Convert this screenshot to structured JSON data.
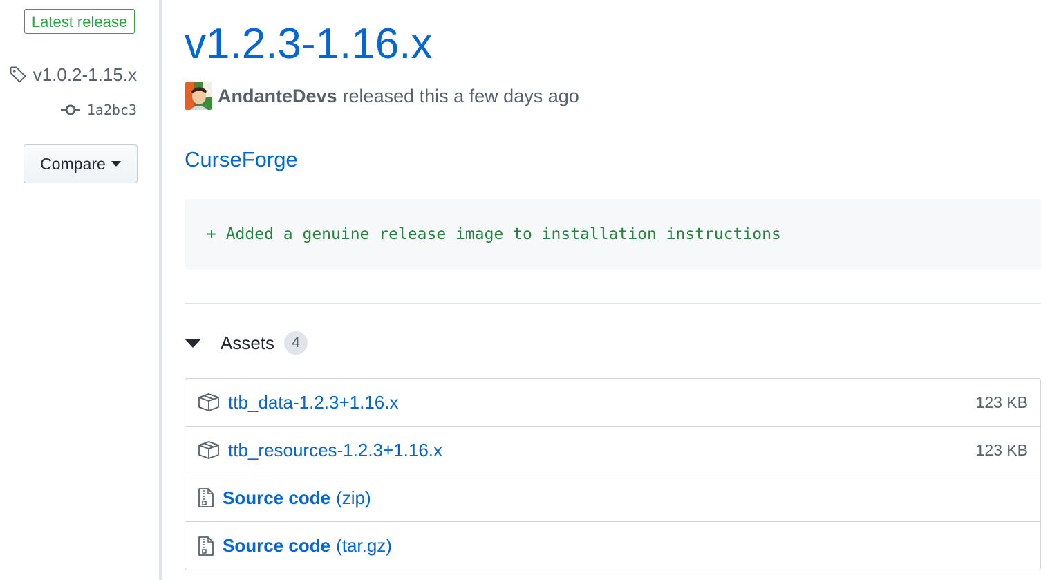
{
  "sidebar": {
    "latest_badge": "Latest release",
    "tag": "v1.0.2-1.15.x",
    "commit": "1a2bc3",
    "compare_label": "Compare"
  },
  "release": {
    "title": "v1.2.3-1.16.x",
    "author": "AndanteDevs",
    "released_text": "released this a few days ago",
    "link_text": "CurseForge",
    "changelog": "+ Added a genuine release image to installation instructions"
  },
  "assets": {
    "label": "Assets",
    "count": "4",
    "items": [
      {
        "name": "ttb_data-1.2.3+1.16.x",
        "size": "123 KB",
        "icon": "package-icon"
      },
      {
        "name": "ttb_resources-1.2.3+1.16.x",
        "size": "123 KB",
        "icon": "package-icon"
      },
      {
        "name": "Source code",
        "suffix": "(zip)",
        "icon": "file-zip-icon"
      },
      {
        "name": "Source code",
        "suffix": "(tar.gz)",
        "icon": "file-zip-icon"
      }
    ]
  },
  "colors": {
    "link": "#0366d6",
    "latest_green": "#28a745",
    "diff_green": "#22863a",
    "muted": "#586069"
  }
}
